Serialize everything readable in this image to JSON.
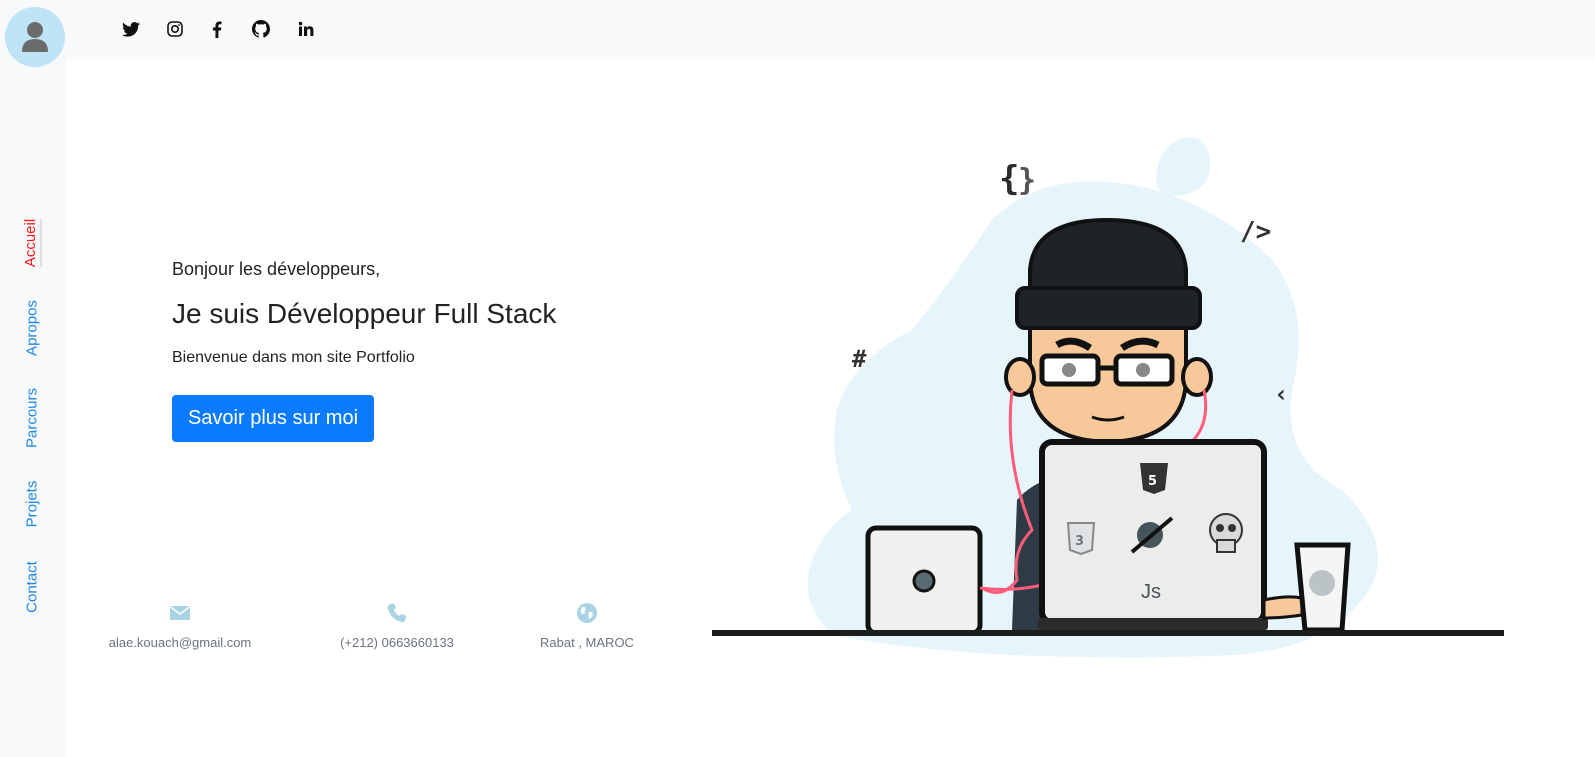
{
  "sidebar": {
    "avatar_icon": "user-icon",
    "items": [
      {
        "label": "Accueil",
        "active": true
      },
      {
        "label": "Apropos"
      },
      {
        "label": "Parcours"
      },
      {
        "label": "Projets"
      },
      {
        "label": "Contact"
      }
    ]
  },
  "topbar": {
    "social_icons": [
      "twitter-icon",
      "instagram-icon",
      "facebook-icon",
      "github-icon",
      "linkedin-icon"
    ]
  },
  "hero": {
    "greeting": "Bonjour les développeurs,",
    "title": "Je suis Développeur Full Stack",
    "subtitle": "Bienvenue dans mon site Portfolio",
    "cta_label": "Savoir plus sur moi"
  },
  "contact": {
    "email": "alae.kouach@gmail.com",
    "phone": "(+212) 0663660133",
    "location": "Rabat , MAROC"
  },
  "illustration": {
    "laptop_labels": [
      "Js"
    ]
  },
  "colors": {
    "accent": "#0a7bff",
    "active_nav": "#ff1a1a",
    "nav": "#1e88e5",
    "info_icon": "#a8d4e6",
    "blob": "#e6f4fb"
  }
}
